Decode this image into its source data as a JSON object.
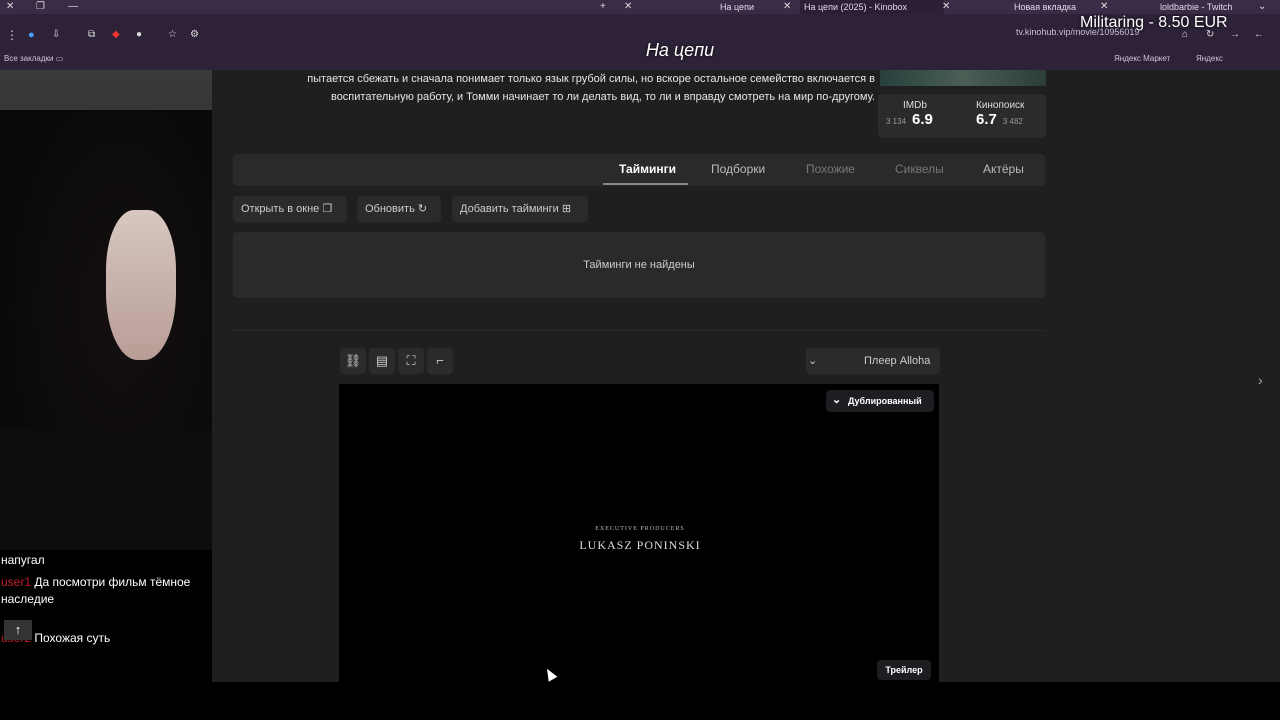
{
  "overlay": {
    "stream_title": "На цепи",
    "donation": "Militaring - 8.50 EUR"
  },
  "browser": {
    "tabs": [
      {
        "label": "loldbarbie - Twitch"
      },
      {
        "label": "Новая вкладка"
      },
      {
        "label": "На цепи (2025) - Kinobox"
      },
      {
        "label": "На цепи"
      }
    ],
    "url": "tv.kinohub.vip/movie/10956019",
    "bookmarks": {
      "yandex": "Яндекс",
      "yandex_market": "Яндекс Маркет",
      "all_bookmarks": "Все закладки"
    }
  },
  "movie": {
    "description": "пытается сбежать и сначала понимает только язык грубой силы, но вскоре остальное семейство включается в воспитательную работу, и Томми начинает то ли делать вид, то ли и вправду смотреть на мир по-другому.",
    "ratings": [
      {
        "source": "Кинопоиск",
        "value": "6.7",
        "count": "3 482"
      },
      {
        "source": "IMDb",
        "value": "6.9",
        "count": "3 134"
      }
    ]
  },
  "page_tabs": [
    {
      "label": "Актёры",
      "state": "normal"
    },
    {
      "label": "Сиквелы",
      "state": "dim"
    },
    {
      "label": "Похожие",
      "state": "dim"
    },
    {
      "label": "Подборки",
      "state": "normal"
    },
    {
      "label": "Тайминги",
      "state": "active"
    }
  ],
  "actions": {
    "add_timing": "Добавить тайминги",
    "refresh": "Обновить",
    "open_window": "Открыть в окне"
  },
  "timings_empty": "Тайминги не найдены",
  "player": {
    "selected": "Плеер Alloha",
    "dub_select": "Дублированный",
    "credit_small": "EXECUTIVE PRODUCERS",
    "credit_big": "LUKASZ PONINSKI",
    "trailer_badge": "Трейлер"
  },
  "chat": {
    "lines": [
      {
        "user": "",
        "text": "напугал"
      },
      {
        "user": "user1",
        "text": "Да посмотри фильм тёмное наследие"
      },
      {
        "user": "user2",
        "text": "Похожая суть"
      }
    ]
  },
  "colors": {
    "tabbar": "#3a2b47",
    "content_bg": "#1f1f22",
    "chat_username": "#c21a2a"
  }
}
